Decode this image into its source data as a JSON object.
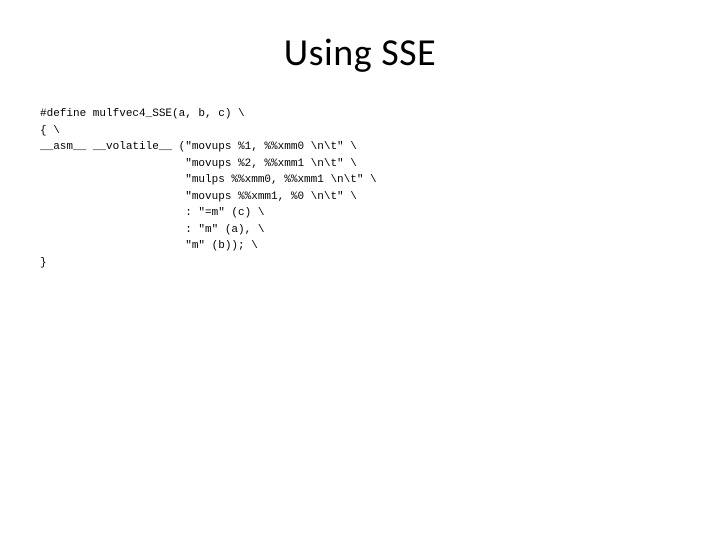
{
  "title": "Using SSE",
  "code": "#define mulfvec4_SSE(a, b, c) \\\n{ \\\n__asm__ __volatile__ (\"movups %1, %%xmm0 \\n\\t\" \\\n                      \"movups %2, %%xmm1 \\n\\t\" \\\n                      \"mulps %%xmm0, %%xmm1 \\n\\t\" \\\n                      \"movups %%xmm1, %0 \\n\\t\" \\\n                      : \"=m\" (c) \\\n                      : \"m\" (a), \\\n                      \"m\" (b)); \\\n}"
}
